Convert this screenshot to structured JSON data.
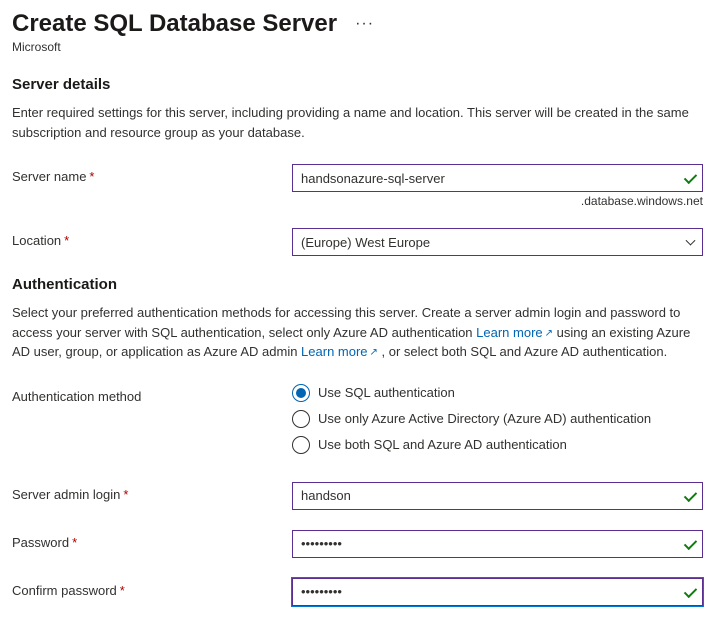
{
  "header": {
    "title": "Create SQL Database Server",
    "publisher": "Microsoft"
  },
  "server_details": {
    "heading": "Server details",
    "desc": "Enter required settings for this server, including providing a name and location. This server will be created in the same subscription and resource group as your database.",
    "server_name_label": "Server name",
    "server_name_value": "handsonazure-sql-server",
    "server_name_suffix": ".database.windows.net",
    "location_label": "Location",
    "location_value": "(Europe) West Europe"
  },
  "auth": {
    "heading": "Authentication",
    "desc_part1": "Select your preferred authentication methods for accessing this server. Create a server admin login and password to access your server with SQL authentication, select only Azure AD authentication ",
    "link1": "Learn more",
    "desc_part2": " using an existing Azure AD user, group, or application as Azure AD admin ",
    "link2": "Learn more",
    "desc_part3": " , or select both SQL and Azure AD authentication.",
    "method_label": "Authentication method",
    "radios": [
      "Use SQL authentication",
      "Use only Azure Active Directory (Azure AD) authentication",
      "Use both SQL and Azure AD authentication"
    ],
    "admin_login_label": "Server admin login",
    "admin_login_value": "handson",
    "password_label": "Password",
    "password_value": "•••••••••",
    "confirm_label": "Confirm password",
    "confirm_value": "•••••••••"
  }
}
